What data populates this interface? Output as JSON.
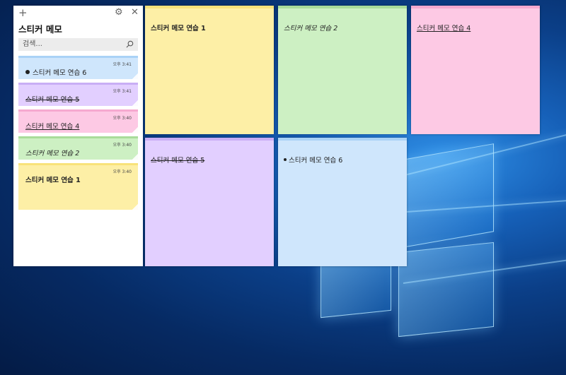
{
  "colors": {
    "yellow": "#fdefa6",
    "yellow_bar": "#f8e27a",
    "green": "#cdf0c3",
    "green_bar": "#a9dc9a",
    "pink": "#fdc9e4",
    "pink_bar": "#f6a9cf",
    "purple": "#e2cfff",
    "purple_bar": "#c9aef5",
    "blue": "#cfe6fc",
    "blue_bar": "#a9d2f6"
  },
  "list_window": {
    "title": "스티커 메모",
    "add_icon": "plus-icon",
    "settings_icon": "gear-icon",
    "close_icon": "close-icon",
    "search_placeholder": "검색...",
    "notes": [
      {
        "text": "스티커 메모 연습 6",
        "time": "오후 3:41",
        "color": "blue",
        "format": "bullet"
      },
      {
        "text": "스티커 메모 연습 5",
        "time": "오후 3:41",
        "color": "purple",
        "format": "strike"
      },
      {
        "text": "스티커 메모 연습 4",
        "time": "오후 3:40",
        "color": "pink",
        "format": "underline"
      },
      {
        "text": "스티커 메모 연습 2",
        "time": "오후 3:40",
        "color": "green",
        "format": "italic"
      },
      {
        "text": "스티커 메모 연습 1",
        "time": "오후 3:40",
        "color": "yellow",
        "format": "bold"
      }
    ]
  },
  "note_windows": [
    {
      "text": "스티커 메모 연습 1",
      "color": "yellow",
      "format": "bold"
    },
    {
      "text": "스티커 메모 연습 2",
      "color": "green",
      "format": "italic"
    },
    {
      "text": "스티커 메모 연습 4",
      "color": "pink",
      "format": "underline"
    },
    {
      "text": "스티커 메모 연습 5",
      "color": "purple",
      "format": "strike"
    },
    {
      "text": "스티커 메모 연습 6",
      "color": "blue",
      "format": "bullet"
    }
  ]
}
